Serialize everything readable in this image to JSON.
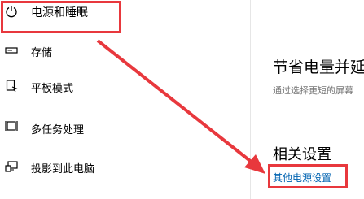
{
  "sidebar": {
    "items": [
      {
        "label": "电源和睡眠",
        "icon": "power-icon"
      },
      {
        "label": "存储",
        "icon": "storage-icon"
      },
      {
        "label": "平板模式",
        "icon": "tablet-mode-icon"
      },
      {
        "label": "多任务处理",
        "icon": "multitasking-icon"
      },
      {
        "label": "投影到此电脑",
        "icon": "project-to-pc-icon"
      }
    ]
  },
  "main": {
    "section_title": "节省电量并延长",
    "section_desc": "通过选择更短的屏幕",
    "related_title": "相关设置",
    "power_link": "其他电源设置"
  },
  "colors": {
    "highlight": "#e8383d",
    "link": "#0063b1"
  }
}
